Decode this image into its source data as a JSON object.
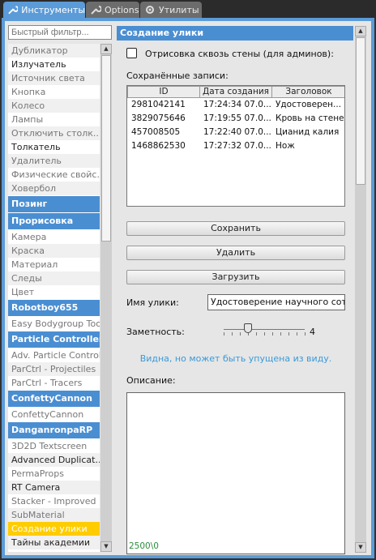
{
  "tabs": [
    {
      "label": "Инструменты",
      "icon": "wrench-icon",
      "active": true
    },
    {
      "label": "Options",
      "icon": "wrench-icon",
      "active": false
    },
    {
      "label": "Утилиты",
      "icon": "gear-icon",
      "active": false
    }
  ],
  "filter": {
    "placeholder": "Быстрый фильтр..."
  },
  "categories": [
    {
      "label": "Дубликатор",
      "type": "item",
      "dim": true
    },
    {
      "label": "Излучатель",
      "type": "item",
      "dim": false
    },
    {
      "label": "Источник света",
      "type": "item",
      "dim": true
    },
    {
      "label": "Кнопка",
      "type": "item",
      "dim": true
    },
    {
      "label": "Колесо",
      "type": "item",
      "dim": true
    },
    {
      "label": "Лампы",
      "type": "item",
      "dim": true
    },
    {
      "label": "Отключить столк...",
      "type": "item",
      "dim": true
    },
    {
      "label": "Толкатель",
      "type": "item",
      "dim": false
    },
    {
      "label": "Удалитель",
      "type": "item",
      "dim": true
    },
    {
      "label": "Физические свойс...",
      "type": "item",
      "dim": true
    },
    {
      "label": "Ховербол",
      "type": "item",
      "dim": true
    },
    {
      "label": "Позинг",
      "type": "header"
    },
    {
      "label": "Прорисовка",
      "type": "header"
    },
    {
      "label": "Камера",
      "type": "item",
      "dim": true
    },
    {
      "label": "Краска",
      "type": "item",
      "dim": true
    },
    {
      "label": "Материал",
      "type": "item",
      "dim": true
    },
    {
      "label": "Следы",
      "type": "item",
      "dim": true
    },
    {
      "label": "Цвет",
      "type": "item",
      "dim": true
    },
    {
      "label": "Robotboy655",
      "type": "header"
    },
    {
      "label": "Easy Bodygroup Tool",
      "type": "item",
      "dim": true
    },
    {
      "label": "Particle Controller",
      "type": "header"
    },
    {
      "label": "Adv. Particle Control",
      "type": "item",
      "dim": true
    },
    {
      "label": "ParCtrl - Projectiles",
      "type": "item",
      "dim": true
    },
    {
      "label": "ParCtrl - Tracers",
      "type": "item",
      "dim": true
    },
    {
      "label": "ConfettyCannon",
      "type": "header"
    },
    {
      "label": "ConfettyCannon",
      "type": "item",
      "dim": true
    },
    {
      "label": "DanganronpaRP",
      "type": "header"
    },
    {
      "label": "3D2D Textscreen",
      "type": "item",
      "dim": true
    },
    {
      "label": "Advanced Duplicat...",
      "type": "item",
      "dim": false
    },
    {
      "label": "PermaProps",
      "type": "item",
      "dim": true
    },
    {
      "label": "RT Camera",
      "type": "item",
      "dim": false
    },
    {
      "label": "Stacker - Improved",
      "type": "item",
      "dim": true
    },
    {
      "label": "SubMaterial",
      "type": "item",
      "dim": true
    },
    {
      "label": "Создание улики",
      "type": "selected"
    },
    {
      "label": "Тайны академии",
      "type": "item",
      "dim": false
    }
  ],
  "panel": {
    "title": "Создание улики",
    "wallhack_label": "Отрисовка сквозь стены (для админов):",
    "saved_label": "Сохранённые записи:",
    "columns": [
      "ID",
      "Дата создания",
      "Заголовок"
    ],
    "rows": [
      [
        "2981042141",
        "17:24:34 07.0...",
        "Удостоверен..."
      ],
      [
        "3829075646",
        "17:19:55 07.0...",
        "Кровь на стене"
      ],
      [
        "457008505",
        "17:22:40 07.0...",
        "Цианид калия"
      ],
      [
        "1468862530",
        "17:27:32 07.0...",
        "Нож"
      ]
    ],
    "save_btn": "Сохранить",
    "delete_btn": "Удалить",
    "load_btn": "Загрузить",
    "name_label": "Имя улики:",
    "name_value": "Удостоверение научного сотрудника",
    "visibility_label": "Заметность:",
    "visibility_value": "4",
    "visibility_level": 0.3,
    "hint": "Видна, но может быть упущена из виду.",
    "desc_label": "Описание:",
    "counter": "2500\\0"
  }
}
